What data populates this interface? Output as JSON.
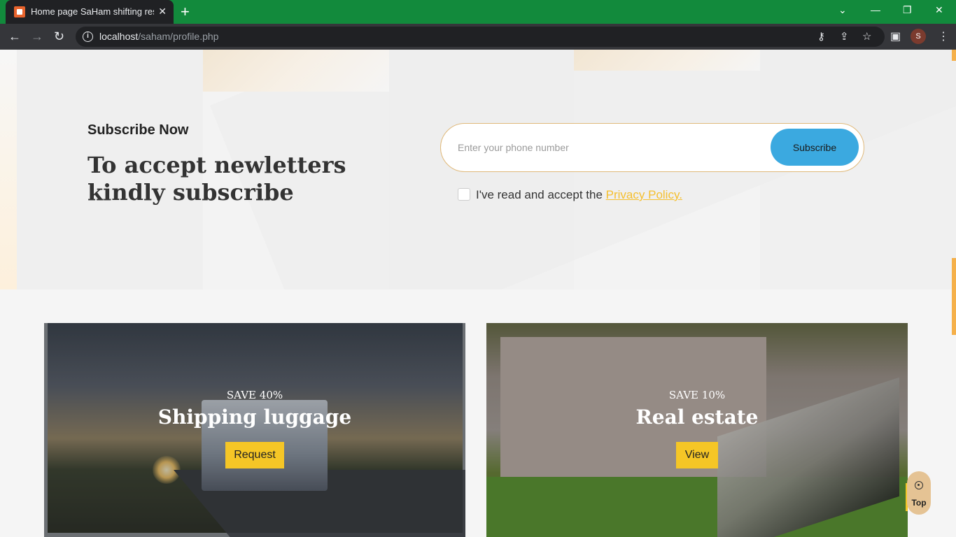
{
  "browser": {
    "tab_title": "Home page SaHam shifting residence",
    "tab_close": "✕",
    "new_tab": "+",
    "url_host": "localhost",
    "url_path": "/saham/profile.php",
    "avatar_letter": "S",
    "window_controls": {
      "dropdown": "⌄",
      "minimize": "—",
      "restore": "❐",
      "close": "✕"
    }
  },
  "subscribe": {
    "heading": "Subscribe Now",
    "title": "To accept newletters kindly subscribe",
    "input_placeholder": "Enter your phone number",
    "button_label": "Subscribe",
    "consent_text": "I've read and accept the ",
    "policy_link": "Privacy Policy."
  },
  "cards": [
    {
      "save": "SAVE 40%",
      "title": "Shipping luggage",
      "button": "Request"
    },
    {
      "save": "SAVE 10%",
      "title": "Real estate",
      "button": "View"
    }
  ],
  "back_to_top": {
    "label": "Top"
  },
  "colors": {
    "titlebar": "#128a3c",
    "accent_yellow": "#f5c626",
    "subscribe_button": "#3ba9e0",
    "policy_link": "#f5bf2e"
  }
}
